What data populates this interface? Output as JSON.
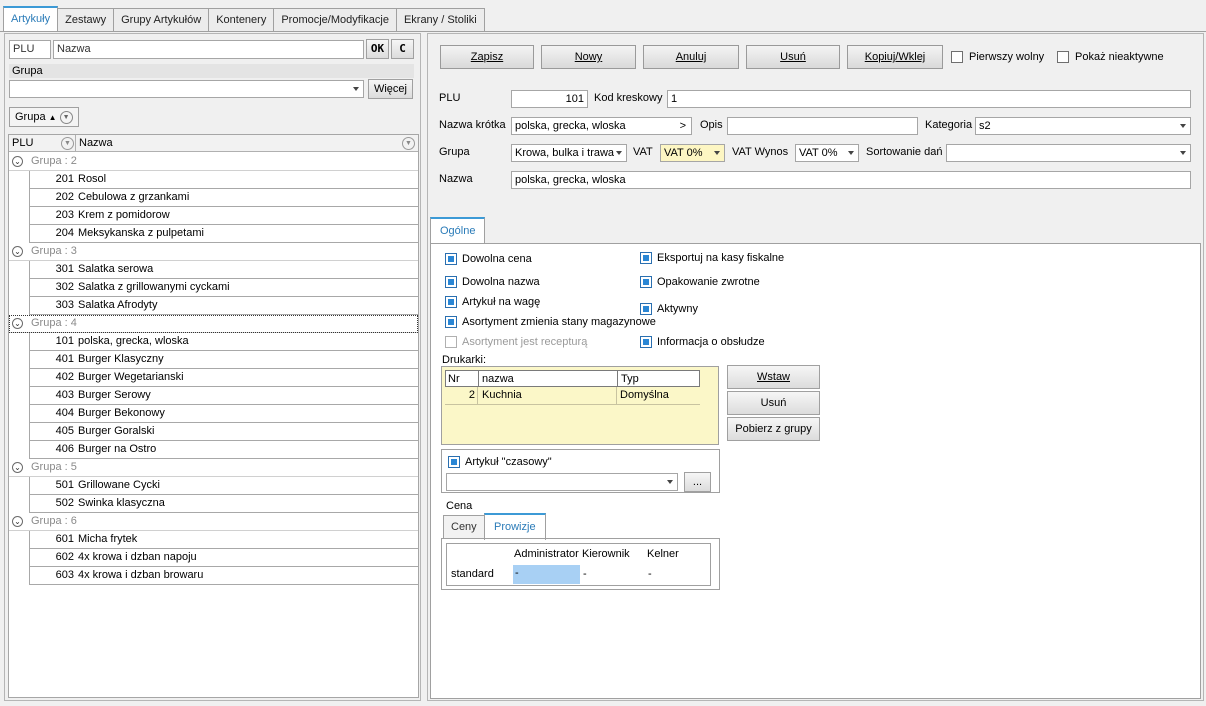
{
  "tabs": [
    "Artykuły",
    "Zestawy",
    "Grupy Artykułów",
    "Kontenery",
    "Promocje/Modyfikacje",
    "Ekrany / Stoliki"
  ],
  "filter": {
    "plu_placeholder": "PLU",
    "name_placeholder": "Nazwa",
    "ok_label": "OK",
    "clear_label": "C",
    "group_label": "Grupa",
    "group_value": "",
    "more_label": "Więcej",
    "group_sort_label": "Grupa"
  },
  "grid": {
    "col_plu": "PLU",
    "col_name": "Nazwa",
    "groups": [
      {
        "label": "Grupa : 2",
        "items": [
          [
            "201",
            "Rosol"
          ],
          [
            "202",
            "Cebulowa z grzankami"
          ],
          [
            "203",
            "Krem z pomidorow"
          ],
          [
            "204",
            "Meksykanska z pulpetami"
          ]
        ]
      },
      {
        "label": "Grupa : 3",
        "items": [
          [
            "301",
            "Salatka serowa"
          ],
          [
            "302",
            "Salatka z grillowanymi cyckami"
          ],
          [
            "303",
            "Salatka Afrodyty"
          ]
        ]
      },
      {
        "label": "Grupa : 4",
        "items": [
          [
            "101",
            "polska, grecka, wloska"
          ],
          [
            "401",
            "Burger Klasyczny"
          ],
          [
            "402",
            "Burger Wegetarianski"
          ],
          [
            "403",
            "Burger Serowy"
          ],
          [
            "404",
            "Burger Bekonowy"
          ],
          [
            "405",
            "Burger Goralski"
          ],
          [
            "406",
            "Burger na Ostro"
          ]
        ]
      },
      {
        "label": "Grupa : 5",
        "items": [
          [
            "501",
            "Grillowane Cycki"
          ],
          [
            "502",
            "Swinka klasyczna"
          ]
        ]
      },
      {
        "label": "Grupa : 6",
        "items": [
          [
            "601",
            "Micha frytek"
          ],
          [
            "602",
            "4x krowa i dzban napoju"
          ],
          [
            "603",
            "4x krowa i dzban browaru"
          ]
        ]
      }
    ]
  },
  "toolbar": {
    "save": "Zapisz",
    "new": "Nowy",
    "cancel": "Anuluj",
    "delete": "Usuń",
    "copy": "Kopiuj/Wklej",
    "first_free": "Pierwszy wolny",
    "show_inactive": "Pokaż nieaktywne"
  },
  "form": {
    "plu_label": "PLU",
    "plu_value": "101",
    "barcode_label": "Kod kreskowy",
    "barcode_value": "1",
    "short_name_label": "Nazwa krótka",
    "short_name_value": "polska, grecka, wloska",
    "desc_label": "Opis",
    "desc_value": "",
    "category_label": "Kategoria",
    "category_value": "s2",
    "group_label": "Grupa",
    "group_value": "Krowa, bulka i trawa",
    "vat_label": "VAT",
    "vat_value": "VAT 0%",
    "vat_out_label": "VAT Wynos",
    "vat_out_value": "VAT 0%",
    "sort_label": "Sortowanie dań",
    "sort_value": "",
    "name_label": "Nazwa",
    "name_value": "polska, grecka, wloska"
  },
  "general": {
    "tab": "Ogólne",
    "any_price": "Dowolna cena",
    "any_name": "Dowolna nazwa",
    "by_weight": "Artykuł na wagę",
    "stock": "Asortyment zmienia stany magazynowe",
    "recipe": "Asortyment jest recepturą",
    "export": "Eksportuj na kasy fiskalne",
    "packaging": "Opakowanie zwrotne",
    "active": "Aktywny",
    "service_info": "Informacja o obsłudze",
    "printers_label": "Drukarki:",
    "printers_cols": [
      "Nr",
      "nazwa",
      "Typ"
    ],
    "printers_rows": [
      [
        "2",
        "Kuchnia",
        "Domyślna"
      ]
    ],
    "insert": "Wstaw",
    "remove": "Usuń",
    "from_group": "Pobierz z grupy",
    "timed": "Artykuł \"czasowy\"",
    "timed_value": "",
    "dots": "...",
    "price_label": "Cena",
    "price_tabs": [
      "Ceny",
      "Prowizje"
    ],
    "price_cols": [
      "Administrator",
      "Kierownik",
      "Kelner"
    ],
    "price_row_label": "standard",
    "price_row_values": [
      "-",
      "-",
      "-"
    ]
  }
}
